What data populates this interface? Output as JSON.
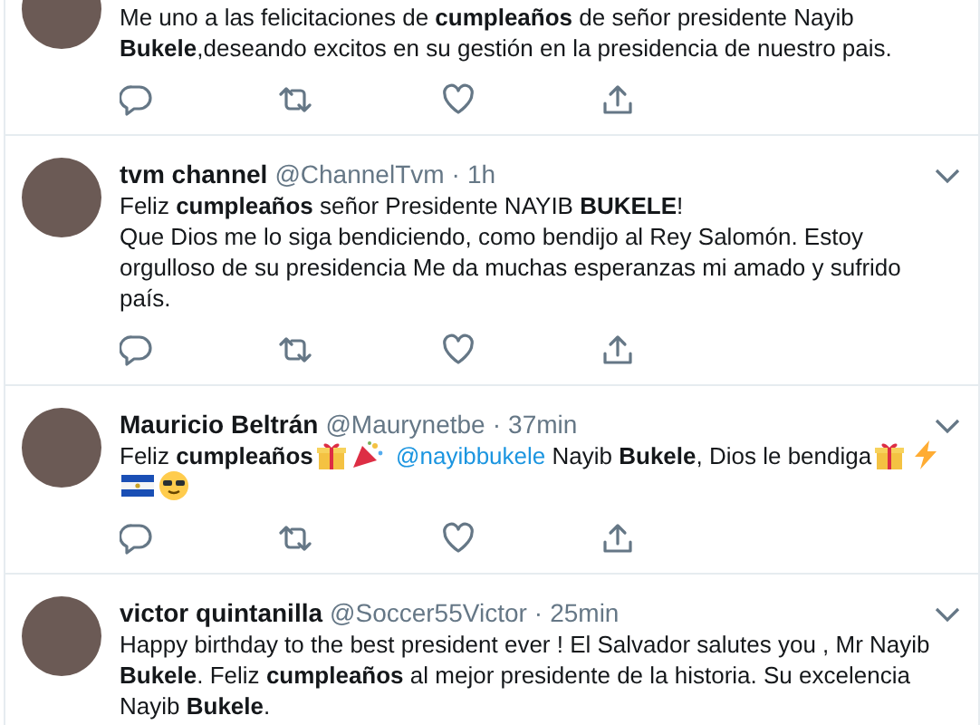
{
  "tweets": [
    {
      "body": [
        [
          {
            "kind": "text",
            "text": "Me uno a las felicitaciones de **cumpleaños** de señor presidente Nayib"
          }
        ],
        [
          {
            "kind": "text",
            "text": "**Bukele**,deseando excitos en su gestión en la presidencia de nuestro pais."
          }
        ]
      ]
    },
    {
      "name": "tvm channel",
      "handle": "@ChannelTvm",
      "separator": "·",
      "time": "1h",
      "body": [
        [
          {
            "kind": "text",
            "text": "Feliz **cumpleaños** señor Presidente NAYIB **BUKELE**!"
          }
        ],
        [
          {
            "kind": "text",
            "text": "Que Dios me lo siga bendiciendo, como bendijo al Rey Salomón. Estoy"
          }
        ],
        [
          {
            "kind": "text",
            "text": "orgulloso de su presidencia Me da muchas esperanzas mi amado y sufrido"
          }
        ],
        [
          {
            "kind": "text",
            "text": "país."
          }
        ]
      ]
    },
    {
      "name": "Mauricio Beltrán",
      "handle": "@Maurynetbe",
      "separator": "·",
      "time": "37min",
      "body": [
        [
          {
            "kind": "text",
            "text": "Feliz **cumpleaños**"
          },
          {
            "kind": "gift"
          },
          {
            "kind": "party"
          },
          {
            "kind": "mention",
            "text": "@nayibbukele"
          },
          {
            "kind": "text",
            "text": " Nayib **Bukele**, Dios le bendiga"
          },
          {
            "kind": "gift"
          },
          {
            "kind": "bolt"
          }
        ],
        [
          {
            "kind": "flag"
          },
          {
            "kind": "sunglasses"
          }
        ]
      ]
    },
    {
      "name": "victor quintanilla",
      "handle": "@Soccer55Victor",
      "separator": "·",
      "time": "25min",
      "body": [
        [
          {
            "kind": "text",
            "text": "Happy birthday to the best president ever !  El Salvador salutes you , Mr Nayib"
          }
        ],
        [
          {
            "kind": "text",
            "text": "**Bukele**. Feliz **cumpleaños** al mejor presidente de la historia. Su excelencia"
          }
        ],
        [
          {
            "kind": "text",
            "text": "Nayib  **Bukele**."
          }
        ]
      ]
    }
  ]
}
